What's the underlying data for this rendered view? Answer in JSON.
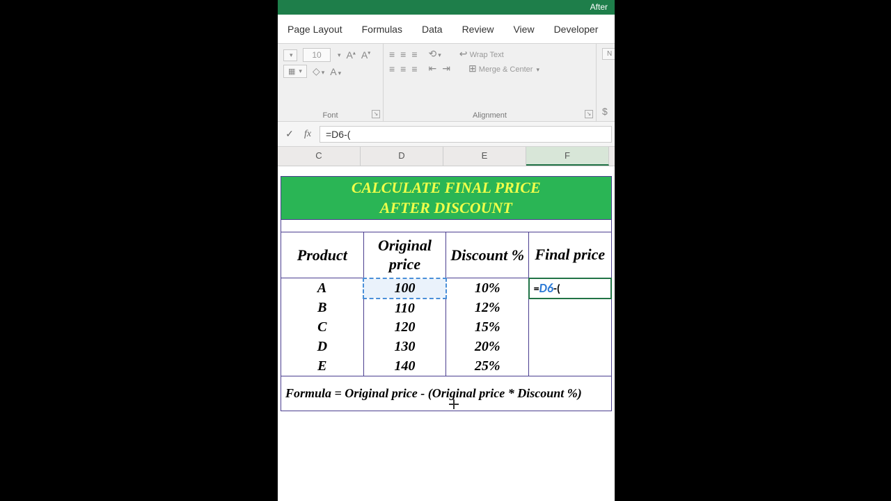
{
  "titlebar": {
    "text": "After"
  },
  "ribbonTabs": {
    "pageLayout": "Page Layout",
    "formulas": "Formulas",
    "data": "Data",
    "review": "Review",
    "view": "View",
    "developer": "Developer"
  },
  "ribbon": {
    "fontSize": "10",
    "wrapText": "Wrap Text",
    "mergeCenter": "Merge & Center",
    "fontGroup": "Font",
    "alignmentGroup": "Alignment"
  },
  "formulaBar": {
    "value": "=D6-("
  },
  "columns": {
    "c": "C",
    "d": "D",
    "e": "E",
    "f": "F"
  },
  "sheetTitle": {
    "line1": "CALCULATE FINAL PRICE",
    "line2": "AFTER DISCOUNT"
  },
  "headers": {
    "product": "Product",
    "original": "Original price",
    "discount": "Discount %",
    "final": "Final price"
  },
  "rows": [
    {
      "product": "A",
      "original": "100",
      "discount": "10%",
      "final": ""
    },
    {
      "product": "B",
      "original": "110",
      "discount": "12%",
      "final": ""
    },
    {
      "product": "C",
      "original": "120",
      "discount": "15%",
      "final": ""
    },
    {
      "product": "D",
      "original": "130",
      "discount": "20%",
      "final": ""
    },
    {
      "product": "E",
      "original": "140",
      "discount": "25%",
      "final": ""
    }
  ],
  "editingFormula": {
    "prefix": "=",
    "ref": "D6",
    "suffix": "-("
  },
  "formulaNote": "Formula  = Original price - (Original price * Discount %)",
  "chart_data": {
    "type": "table",
    "title": "CALCULATE FINAL PRICE AFTER DISCOUNT",
    "columns": [
      "Product",
      "Original price",
      "Discount %",
      "Final price"
    ],
    "rows": [
      [
        "A",
        100,
        0.1,
        null
      ],
      [
        "B",
        110,
        0.12,
        null
      ],
      [
        "C",
        120,
        0.15,
        null
      ],
      [
        "D",
        130,
        0.2,
        null
      ],
      [
        "E",
        140,
        0.25,
        null
      ]
    ],
    "formula": "Final price = Original price - (Original price * Discount %)"
  }
}
